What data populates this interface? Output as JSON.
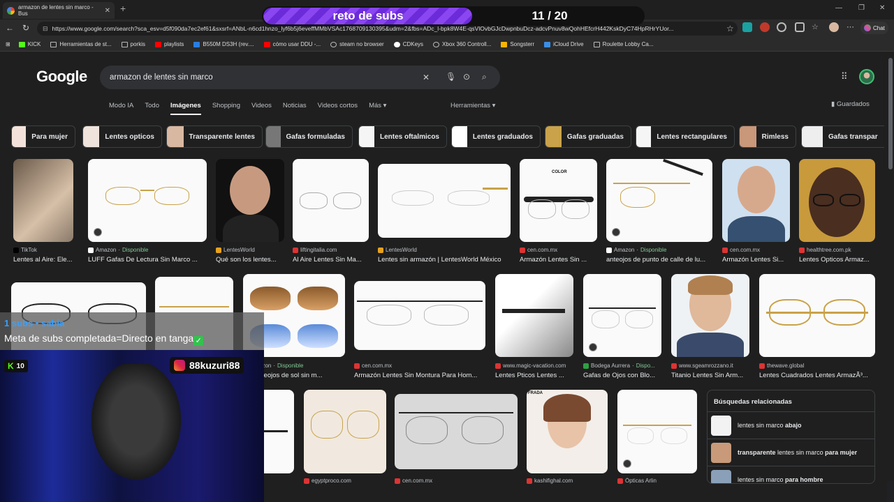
{
  "browser": {
    "tab_title": "armazon de lentes sin marco - Bus",
    "url": "https://www.google.com/search?sca_esv=d5f090da7ec2ef61&sxsrf=ANbL-n6cd1hnzo_lyf6b5j6eveffMMbVSAc1768709130395&udm=2&fbs=ADc_l-bpk8W4E-qsVlOvbGJcDwpnbuDcz-adcvPnuv8wQohHEfcrH442KskDyC74HpRHrYUor...",
    "chat_label": "Chat",
    "bookmarks": [
      "KICK",
      "Herramientas de st...",
      "porkis",
      "playlists",
      "B550M DS3H (rev....",
      "cómo usar DDU -...",
      "steam no browser",
      "CDKeys",
      "Xbox 360 Controll...",
      "Songsterr",
      "iCloud Drive",
      "Roulette Lobby Ca..."
    ]
  },
  "overlay": {
    "banner_title": "reto de subs",
    "banner_count": "11 / 20",
    "banner_progress": 0.55,
    "goal_small": "1 subs • sabia",
    "goal_text": "Meta de subs completada=Directo en tanga",
    "kick_count": "10",
    "instagram": "88kuzuri88"
  },
  "google": {
    "logo": "Google",
    "query": "armazon de lentes sin marco",
    "tabs": [
      "Modo IA",
      "Todo",
      "Imágenes",
      "Shopping",
      "Videos",
      "Noticias",
      "Videos cortos",
      "Más"
    ],
    "active_tab": "Imágenes",
    "tools": "Herramientas",
    "saved": "Guardados",
    "chips": [
      "Para mujer",
      "Lentes opticos",
      "Transparente lentes",
      "Gafas formuladas",
      "Lentes oftalmicos",
      "Lentes graduados",
      "Gafas graduadas",
      "Lentes rectangulares",
      "Rimless",
      "Gafas transpar"
    ],
    "row1": [
      {
        "source": "TikTok",
        "caption": "Lentes al Aire: Ele..."
      },
      {
        "source": "Amazon",
        "avail": "Disponible",
        "caption": "LUFF Gafas De Lectura Sin Marco ..."
      },
      {
        "source": "LentesWorld",
        "caption": "Qué son los lentes..."
      },
      {
        "source": "liftingitalia.com",
        "caption": "Al Aire Lentes Sin Ma..."
      },
      {
        "source": "LentesWorld",
        "caption": "Lentes sin armazón | LentesWorld México"
      },
      {
        "source": "cen.com.mx",
        "caption": "Armazón Lentes Sin ..."
      },
      {
        "source": "Amazon",
        "avail": "Disponible",
        "caption": "anteojos de punto de calle de lu..."
      },
      {
        "source": "cen.com.mx",
        "caption": "Armazón Lentes Si..."
      },
      {
        "source": "healthtree.com.pk",
        "caption": "Lentes Opticos Armaz..."
      }
    ],
    "row2": [
      {
        "source": "Amazon",
        "avail": "Disponible",
        "caption": "M - anteojos de sol sin m..."
      },
      {
        "source": "cen.com.mx",
        "caption": "Armazón Lentes Sin Montura Para Hom..."
      },
      {
        "source": "www.magic-vacation.com",
        "caption": "Lentes Pticos Lentes ..."
      },
      {
        "source": "Bodega Aurrera",
        "avail": "Dispo...",
        "caption": "Gafas de Ojos con Blo..."
      },
      {
        "source": "www.sgeamrozzano.it",
        "caption": "Titanio Lentes Sin Arm..."
      },
      {
        "source": "thewave.global",
        "caption": "Lentes Cuadrados Lentes ArmazÃ³..."
      }
    ],
    "row3_sources": [
      "egyptproco.com",
      "cen.com.mx",
      "kashifighal.com",
      "Ópticas Arlin"
    ],
    "label_color": "COLOR",
    "label_frada": "FRADA",
    "related_title": "Búsquedas relacionadas",
    "related": [
      {
        "plain": "lentes sin marco",
        "bold": "abajo"
      },
      {
        "bold_pre": "transparente",
        "plain": "lentes sin marco",
        "bold": "para mujer"
      },
      {
        "plain": "lentes sin marco",
        "bold": "para hombre"
      }
    ]
  }
}
